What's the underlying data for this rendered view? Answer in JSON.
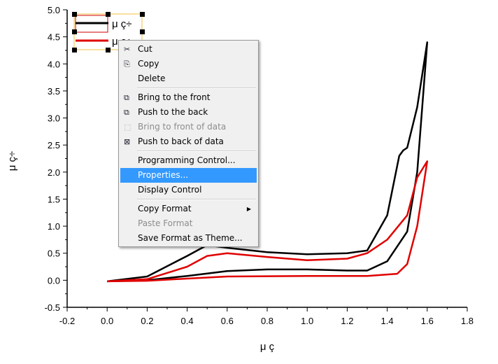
{
  "chart_data": {
    "type": "line",
    "xlabel": "μ ç",
    "ylabel": "μ ç÷",
    "xlim": [
      -0.2,
      1.8
    ],
    "ylim": [
      -0.5,
      5.0
    ],
    "xticks": [
      "-0.2",
      "0.0",
      "0.2",
      "0.4",
      "0.6",
      "0.8",
      "1.0",
      "1.2",
      "1.4",
      "1.6",
      "1.8"
    ],
    "yticks": [
      "-0.5",
      "0.0",
      "0.5",
      "1.0",
      "1.5",
      "2.0",
      "2.5",
      "3.0",
      "3.5",
      "4.0",
      "4.5",
      "5.0"
    ],
    "legend": {
      "placement": "top-left",
      "entries": [
        "μ ç÷",
        "μ ç÷"
      ]
    },
    "series": [
      {
        "color": "#000000",
        "x": [
          0,
          0.2,
          0.4,
          0.6,
          0.8,
          1.0,
          1.2,
          1.3,
          1.4,
          1.5,
          1.55,
          1.6,
          1.55,
          1.5,
          1.48,
          1.46,
          1.4,
          1.3,
          1.2,
          1.0,
          0.8,
          0.6,
          0.5,
          0.4,
          0.2,
          0
        ],
        "y": [
          -0.02,
          0.0,
          0.08,
          0.17,
          0.2,
          0.2,
          0.18,
          0.18,
          0.35,
          0.9,
          2.0,
          4.4,
          3.2,
          2.45,
          2.4,
          2.3,
          1.2,
          0.55,
          0.5,
          0.48,
          0.52,
          0.6,
          0.65,
          0.45,
          0.07,
          -0.02
        ]
      },
      {
        "color": "#e00000",
        "x": [
          0,
          0.2,
          0.4,
          0.6,
          1.0,
          1.3,
          1.45,
          1.5,
          1.55,
          1.6,
          1.55,
          1.5,
          1.4,
          1.3,
          1.2,
          1.0,
          0.8,
          0.6,
          0.5,
          0.4,
          0.2,
          0
        ],
        "y": [
          -0.02,
          -0.01,
          0.03,
          0.07,
          0.08,
          0.08,
          0.12,
          0.3,
          1.0,
          2.2,
          1.9,
          1.2,
          0.75,
          0.5,
          0.4,
          0.37,
          0.43,
          0.5,
          0.45,
          0.25,
          0.02,
          -0.02
        ]
      }
    ]
  },
  "menu": {
    "cut": "Cut",
    "copy": "Copy",
    "delete": "Delete",
    "bring_front": "Bring to the front",
    "push_back": "Push to the back",
    "bring_front_data": "Bring to front of data",
    "push_back_data": "Push to back of data",
    "programming": "Programming Control...",
    "properties": "Properties...",
    "display": "Display Control",
    "copy_format": "Copy Format",
    "paste_format": "Paste Format",
    "save_theme": "Save Format as Theme..."
  }
}
